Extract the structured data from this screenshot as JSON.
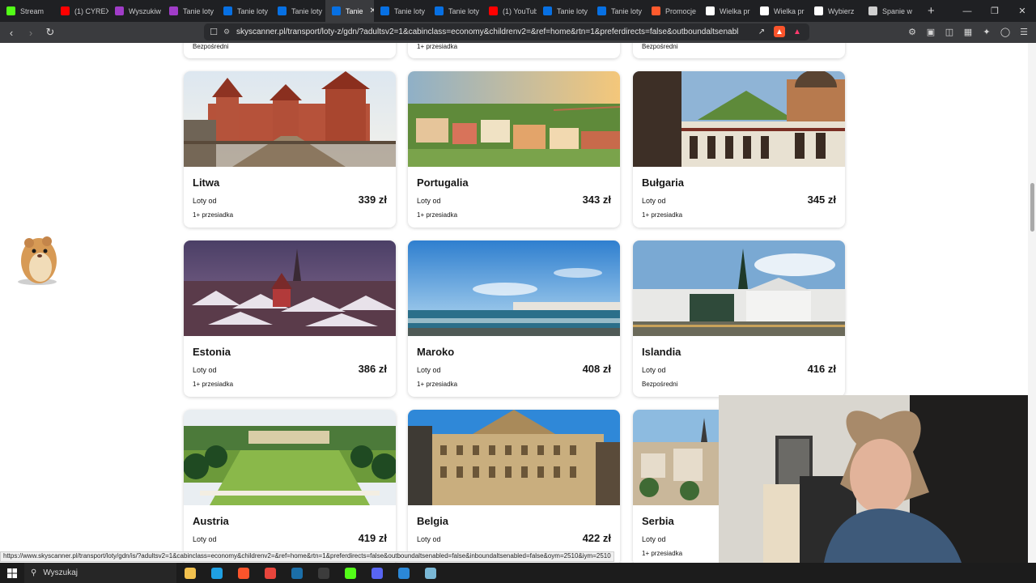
{
  "tabs": [
    {
      "label": "Stream",
      "icon": "kick-icon",
      "color": "#53fc18"
    },
    {
      "label": "(1) CYREX",
      "icon": "youtube-icon",
      "color": "#ff0000"
    },
    {
      "label": "Wyszukiw",
      "icon": "purple-app-icon",
      "color": "#a03cc8"
    },
    {
      "label": "Tanie loty",
      "icon": "purple-app-icon",
      "color": "#a03cc8"
    },
    {
      "label": "Tanie loty",
      "icon": "skyscanner-icon",
      "color": "#0770e3"
    },
    {
      "label": "Tanie loty",
      "icon": "skyscanner-icon",
      "color": "#0770e3"
    },
    {
      "label": "Tanie",
      "icon": "skyscanner-icon",
      "color": "#0770e3",
      "active": true
    },
    {
      "label": "Tanie loty",
      "icon": "skyscanner-icon",
      "color": "#0770e3"
    },
    {
      "label": "Tanie loty",
      "icon": "skyscanner-icon",
      "color": "#0770e3"
    },
    {
      "label": "(1) YouTub",
      "icon": "youtube-icon",
      "color": "#ff0000"
    },
    {
      "label": "Tanie loty",
      "icon": "skyscanner-icon",
      "color": "#0770e3"
    },
    {
      "label": "Tanie loty",
      "icon": "skyscanner-icon",
      "color": "#0770e3"
    },
    {
      "label": "Promocje",
      "icon": "promo-icon",
      "color": "#ff5a2d"
    },
    {
      "label": "Wielka pr",
      "icon": "travel-icon",
      "color": "#ffffff"
    },
    {
      "label": "Wielka pr",
      "icon": "travel-icon",
      "color": "#ffffff"
    },
    {
      "label": "Wybierz",
      "icon": "travel-icon",
      "color": "#ffffff"
    },
    {
      "label": "Spanie w",
      "icon": "globe-icon",
      "color": "#cfcfcf"
    }
  ],
  "address": {
    "url": "skyscanner.pl/transport/loty-z/gdn/?adultsv2=1&cabinclass=economy&childrenv2=&ref=home&rtn=1&preferdirects=false&outboundaltsenabled=..."
  },
  "page": {
    "top_partial": [
      "Bezpośredni",
      "1+ przesiadka",
      "Bezpośredni"
    ],
    "from_label": "Loty od",
    "cards": [
      {
        "name": "Litwa",
        "price": "339 zł",
        "stops": "1+ przesiadka"
      },
      {
        "name": "Portugalia",
        "price": "343 zł",
        "stops": "1+ przesiadka"
      },
      {
        "name": "Bułgaria",
        "price": "345 zł",
        "stops": "1+ przesiadka"
      },
      {
        "name": "Estonia",
        "price": "386 zł",
        "stops": "1+ przesiadka"
      },
      {
        "name": "Maroko",
        "price": "408 zł",
        "stops": "1+ przesiadka"
      },
      {
        "name": "Islandia",
        "price": "416 zł",
        "stops": "Bezpośredni"
      },
      {
        "name": "Austria",
        "price": "419 zł",
        "stops": ""
      },
      {
        "name": "Belgia",
        "price": "422 zł",
        "stops": ""
      },
      {
        "name": "Serbia",
        "price": "",
        "stops": "1+ przesiadka"
      }
    ]
  },
  "status_url": "https://www.skyscanner.pl/transport/loty/gdn/is/?adultsv2=1&cabinclass=economy&childrenv2=&ref=home&rtn=1&preferdirects=false&outboundaltsenabled=false&inboundaltsenabled=false&oym=2510&iym=2510",
  "taskbar": {
    "search_label": "Wyszukaj",
    "apps": [
      {
        "name": "file-explorer-icon",
        "color": "#f2c14e"
      },
      {
        "name": "edge-icon",
        "color": "#1fa0e3"
      },
      {
        "name": "brave-icon",
        "color": "#fb542b"
      },
      {
        "name": "chrome-icon",
        "color": "#e8453c"
      },
      {
        "name": "steam-icon",
        "color": "#1b6ea8"
      },
      {
        "name": "obs-icon",
        "color": "#3c3c3c"
      },
      {
        "name": "kick-app-icon",
        "color": "#53fc18"
      },
      {
        "name": "discord-icon",
        "color": "#5865f2"
      },
      {
        "name": "mail-icon",
        "color": "#2b88d8"
      },
      {
        "name": "app-icon",
        "color": "#7ab8d6"
      }
    ]
  }
}
